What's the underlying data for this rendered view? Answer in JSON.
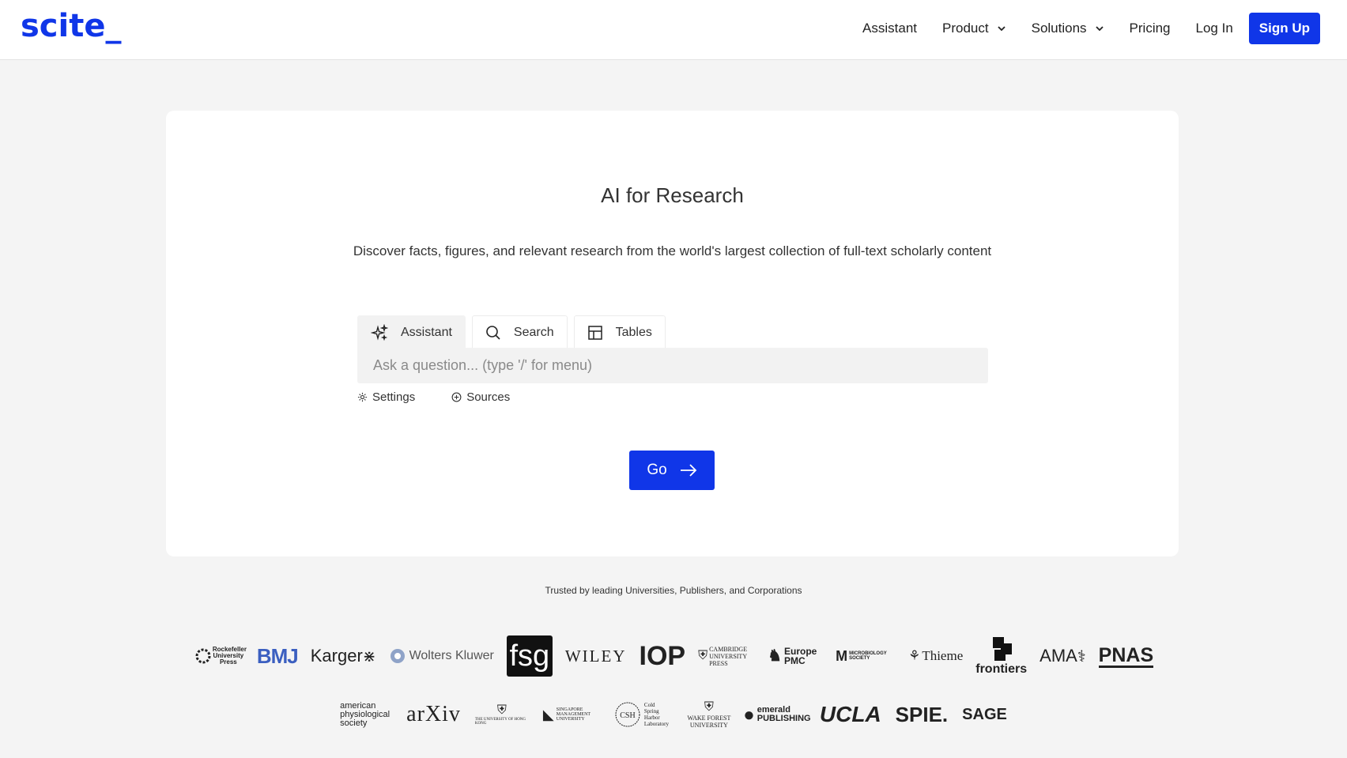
{
  "brand": {
    "logo": "scite_",
    "color": "#1036e8"
  },
  "nav": {
    "items": [
      {
        "label": "Assistant"
      },
      {
        "label": "Product"
      },
      {
        "label": "Solutions"
      },
      {
        "label": "Pricing"
      },
      {
        "label": "Log In"
      }
    ],
    "signup": "Sign Up"
  },
  "hero": {
    "title": "AI for Research",
    "subtitle": "Discover facts, figures, and relevant research from the world's largest collection of full-text scholarly content"
  },
  "search": {
    "tabs": [
      {
        "label": "Assistant",
        "icon": "sparkles-icon",
        "active": true
      },
      {
        "label": "Search",
        "icon": "search-icon",
        "active": false
      },
      {
        "label": "Tables",
        "icon": "table-icon",
        "active": false
      }
    ],
    "placeholder": "Ask a question... (type '/' for menu)",
    "value": "",
    "settings": "Settings",
    "sources": "Sources",
    "go": "Go"
  },
  "trusted": {
    "text": "Trusted by leading Universities, Publishers, and Corporations",
    "logos_row1": [
      "Rockefeller University Press",
      "BMJ",
      "Karger",
      "Wolters Kluwer",
      "fsg",
      "WILEY",
      "IOP",
      "CAMBRIDGE UNIVERSITY PRESS",
      "Europe PMC",
      "MICROBIOLOGY SOCIETY",
      "Thieme",
      "frontiers",
      "AMA",
      "PNAS"
    ],
    "logos_row2": [
      "american physiological society",
      "arXiv",
      "THE UNIVERSITY OF HONG KONG",
      "SINGAPORE MANAGEMENT UNIVERSITY",
      "Cold Spring Harbor Laboratory",
      "WAKE FOREST UNIVERSITY",
      "emerald PUBLISHING",
      "UCLA",
      "SPIE.",
      "SAGE"
    ]
  }
}
